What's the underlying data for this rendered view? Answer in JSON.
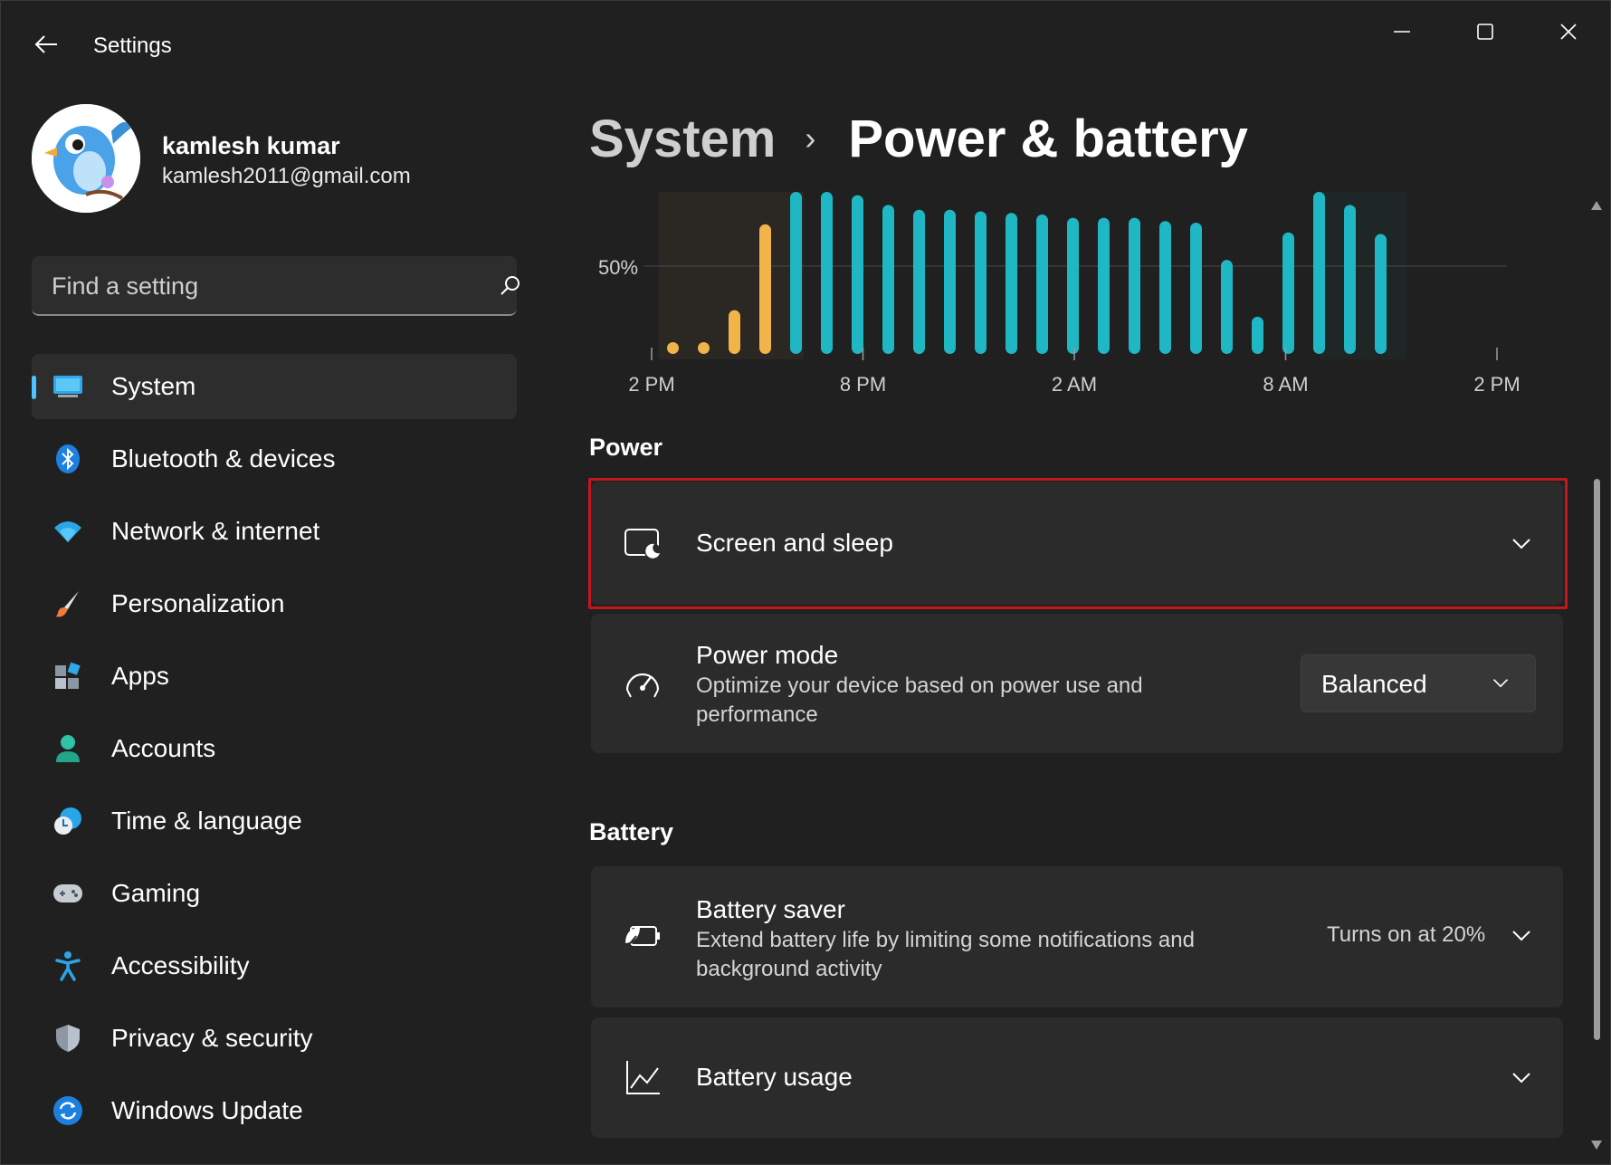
{
  "window": {
    "title": "Settings"
  },
  "profile": {
    "name": "kamlesh kumar",
    "email": "kamlesh2011@gmail.com"
  },
  "search": {
    "placeholder": "Find a setting"
  },
  "sidebar": {
    "items": [
      {
        "label": "System",
        "icon": "system-icon",
        "active": true
      },
      {
        "label": "Bluetooth & devices",
        "icon": "bluetooth-icon"
      },
      {
        "label": "Network & internet",
        "icon": "wifi-icon"
      },
      {
        "label": "Personalization",
        "icon": "brush-icon"
      },
      {
        "label": "Apps",
        "icon": "apps-icon"
      },
      {
        "label": "Accounts",
        "icon": "person-icon"
      },
      {
        "label": "Time & language",
        "icon": "clock-globe-icon"
      },
      {
        "label": "Gaming",
        "icon": "gamepad-icon"
      },
      {
        "label": "Accessibility",
        "icon": "accessibility-icon"
      },
      {
        "label": "Privacy & security",
        "icon": "shield-icon"
      },
      {
        "label": "Windows Update",
        "icon": "update-icon"
      }
    ]
  },
  "breadcrumb": {
    "parent": "System",
    "separator": "›",
    "current": "Power & battery"
  },
  "chart_data": {
    "type": "bar",
    "ylabel_tick": "50%",
    "ylim": [
      0,
      100
    ],
    "x_tick_labels": [
      "2 PM",
      "8 PM",
      "2 AM",
      "8 AM",
      "2 PM"
    ],
    "values": [
      5,
      5,
      27,
      80,
      100,
      100,
      98,
      92,
      89,
      89,
      88,
      87,
      86,
      84,
      84,
      84,
      82,
      81,
      58,
      23,
      75,
      100,
      92,
      74
    ],
    "charging_color": "#f0b44a",
    "battery_color": "#1fb7c3",
    "grid": true
  },
  "power": {
    "section_title": "Power",
    "screen_sleep": {
      "title": "Screen and sleep",
      "icon": "screen-sleep-icon"
    },
    "power_mode": {
      "title": "Power mode",
      "description": "Optimize your device based on power use and performance",
      "value": "Balanced",
      "icon": "power-mode-gauge-icon"
    }
  },
  "battery": {
    "section_title": "Battery",
    "saver": {
      "title": "Battery saver",
      "description": "Extend battery life by limiting some notifications and background activity",
      "status": "Turns on at 20%",
      "icon": "battery-saver-icon"
    },
    "usage": {
      "title": "Battery usage",
      "icon": "chart-line-icon"
    }
  },
  "colors": {
    "accent": "#4cc2ff",
    "highlight": "#c4161c",
    "background": "#202020",
    "card": "#2b2b2b"
  }
}
